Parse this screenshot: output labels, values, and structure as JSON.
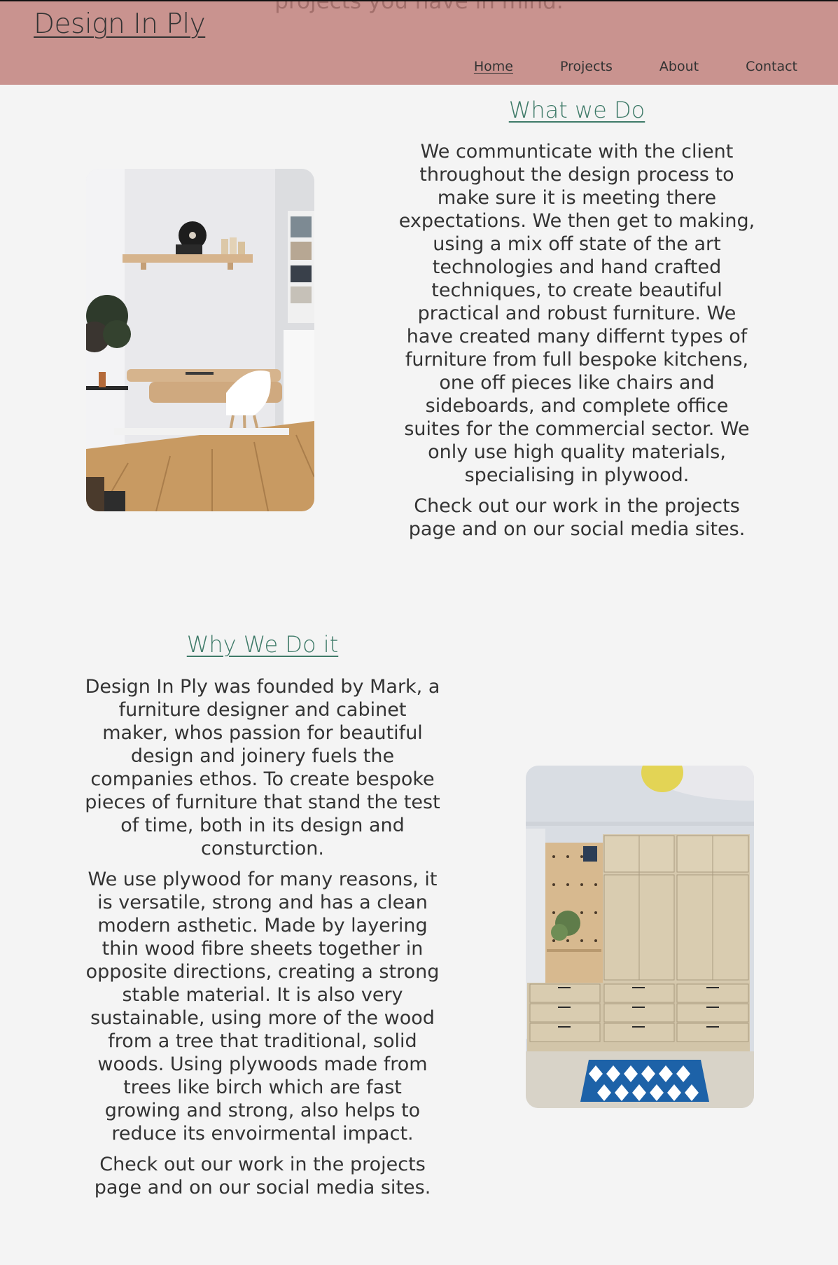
{
  "header": {
    "partial_text": "projects you have in mind.",
    "brand": "Design In Ply",
    "nav": [
      "Home",
      "Projects",
      "About",
      "Contact"
    ],
    "active_nav": "Home"
  },
  "what_we_do": {
    "heading": "What we Do",
    "paragraph_1": "We communticate with the client throughout the design process to make sure it is meeting there expectations. We then get to making, using a mix off state of the art technologies and hand crafted techniques, to create beautiful practical and robust furniture. We have created many differnt types of furniture from full bespoke kitchens, one off pieces like chairs and sideboards, and complete office suites for the commercial sector. We only use high quality materials, specialising in plywood.",
    "paragraph_2": "Check out our work in the projects page and on our social media sites."
  },
  "why_we_do_it": {
    "heading": "Why We Do it",
    "paragraph_1": "Design In Ply was founded by Mark, a furniture designer and cabinet maker, whos passion for beautiful design and joinery fuels the companies ethos. To create bespoke pieces of furniture that stand the test of time, both in its design and consturction.",
    "paragraph_2": "We use plywood for many reasons, it is versatile, strong and has a clean modern asthetic. Made by layering thin wood fibre sheets together in opposite directions, creating a strong stable material. It is also very sustainable, using more of the wood from a tree that traditional, solid woods. Using plywoods made from trees like birch which are fast growing and strong, also helps to reduce its envoirmental impact.",
    "paragraph_3": "Check out our work in the projects page and on our social media sites."
  },
  "colors": {
    "header_bg": "#c9938f",
    "page_bg": "#f4f4f4",
    "heading": "#3e7a68",
    "text": "#333333"
  }
}
